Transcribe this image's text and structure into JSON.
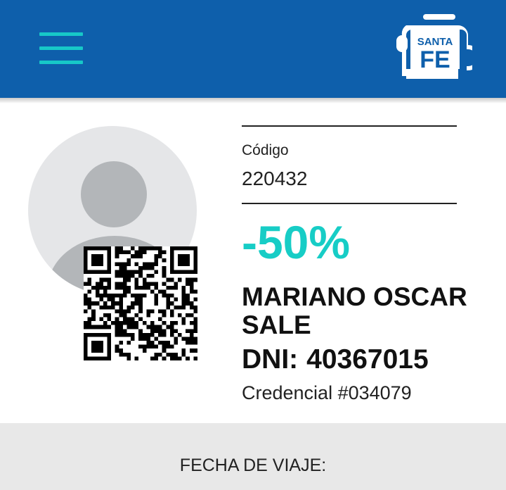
{
  "header": {
    "logo_text_top": "SANTA",
    "logo_text_bottom": "FE",
    "brand_color": "#0e5fab",
    "accent_color": "#17c8c8",
    "menu_icon": "hamburger-menu-icon"
  },
  "card": {
    "codigo_label": "Código",
    "codigo_value": "220432",
    "discount": "-50%",
    "discount_color": "#17cdc6",
    "name": "MARIANO OSCAR SALE",
    "dni_label": "DNI:",
    "dni_value": "40367015",
    "credencial": "Credencial #034079",
    "avatar_icon": "user-avatar-icon",
    "qr_icon": "qr-code-icon"
  },
  "footer": {
    "fecha_label": "FECHA DE VIAJE:"
  }
}
